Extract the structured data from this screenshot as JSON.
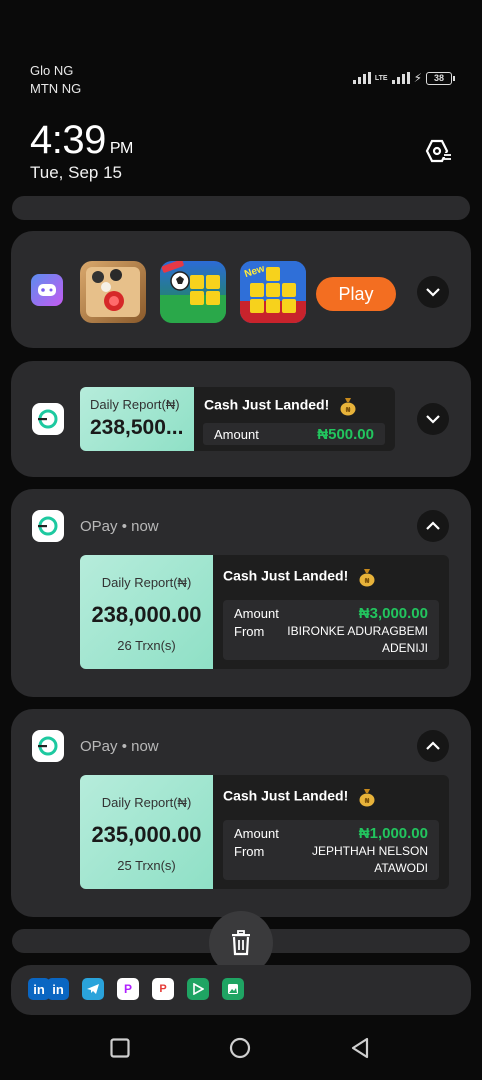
{
  "status": {
    "carrier1": "Glo NG",
    "carrier2": "MTN NG",
    "network": "LTE",
    "battery": "38"
  },
  "clock": {
    "time": "4:39",
    "ampm": "PM",
    "date": "Tue, Sep 15"
  },
  "games_card": {
    "play_label": "Play",
    "tile_badge": "New"
  },
  "collapsed_opay": {
    "report_title": "Daily Report(₦)",
    "report_amount": "238,500...",
    "headline": "Cash Just Landed!",
    "amount_label": "Amount",
    "amount_value": "₦500.00"
  },
  "notifications": [
    {
      "app": "OPay",
      "time": "now",
      "report_title": "Daily Report(₦)",
      "report_amount": "238,000.00",
      "trxn": "26 Trxn(s)",
      "headline": "Cash Just Landed!",
      "amount_label": "Amount",
      "amount_value": "₦3,000.00",
      "from_label": "From",
      "from_line1": "IBIRONKE ADURAGBEMI",
      "from_line2": "ADENIJI"
    },
    {
      "app": "OPay",
      "time": "now",
      "report_title": "Daily Report(₦)",
      "report_amount": "235,000.00",
      "trxn": "25 Trxn(s)",
      "headline": "Cash Just Landed!",
      "amount_label": "Amount",
      "amount_value": "₦1,000.00",
      "from_label": "From",
      "from_line1": "JEPHTHAH NELSON",
      "from_line2": "ATAWODI"
    }
  ],
  "dock_icons": [
    "linkedin-icon",
    "linkedin-icon",
    "telegram-icon",
    "picsart-icon",
    "wps-icon",
    "play-store-icon",
    "gallery-icon"
  ],
  "colors": {
    "accent_orange": "#f36e21",
    "money_green": "#22c55e",
    "report_mint": "#a6e8d2",
    "card_bg": "#2b2b2d"
  }
}
